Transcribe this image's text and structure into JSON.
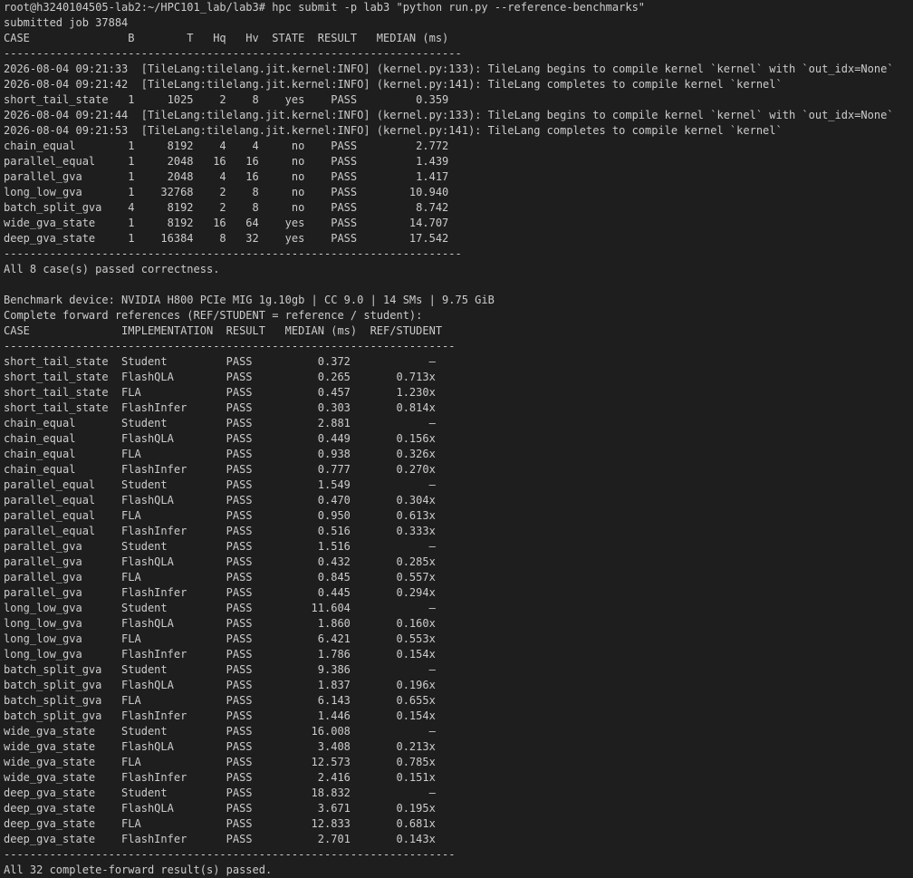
{
  "terminal": {
    "lines": [
      "root@h3240104505-lab2:~/HPC101_lab/lab3# hpc submit -p lab3 \"python run.py --reference-benchmarks\"",
      "submitted job 37884",
      "CASE               B        T   Hq   Hv  STATE  RESULT   MEDIAN (ms)",
      "----------------------------------------------------------------------",
      "2026-08-04 09:21:33  [TileLang:tilelang.jit.kernel:INFO] (kernel.py:133): TileLang begins to compile kernel `kernel` with `out_idx=None`",
      "2026-08-04 09:21:42  [TileLang:tilelang.jit.kernel:INFO] (kernel.py:141): TileLang completes to compile kernel `kernel`",
      "short_tail_state   1     1025    2    8    yes    PASS         0.359",
      "2026-08-04 09:21:44  [TileLang:tilelang.jit.kernel:INFO] (kernel.py:133): TileLang begins to compile kernel `kernel` with `out_idx=None`",
      "2026-08-04 09:21:53  [TileLang:tilelang.jit.kernel:INFO] (kernel.py:141): TileLang completes to compile kernel `kernel`",
      "chain_equal        1     8192    4    4     no    PASS         2.772",
      "parallel_equal     1     2048   16   16     no    PASS         1.439",
      "parallel_gva       1     2048    4   16     no    PASS         1.417",
      "long_low_gva       1    32768    2    8     no    PASS        10.940",
      "batch_split_gva    4     8192    2    8     no    PASS         8.742",
      "wide_gva_state     1     8192   16   64    yes    PASS        14.707",
      "deep_gva_state     1    16384    8   32    yes    PASS        17.542",
      "----------------------------------------------------------------------",
      "All 8 case(s) passed correctness.",
      "",
      "Benchmark device: NVIDIA H800 PCIe MIG 1g.10gb | CC 9.0 | 14 SMs | 9.75 GiB",
      "Complete forward references (REF/STUDENT = reference / student):",
      "CASE              IMPLEMENTATION  RESULT   MEDIAN (ms)  REF/STUDENT",
      "---------------------------------------------------------------------",
      "short_tail_state  Student         PASS          0.372            —",
      "short_tail_state  FlashQLA        PASS          0.265       0.713x",
      "short_tail_state  FLA             PASS          0.457       1.230x",
      "short_tail_state  FlashInfer      PASS          0.303       0.814x",
      "chain_equal       Student         PASS          2.881            —",
      "chain_equal       FlashQLA        PASS          0.449       0.156x",
      "chain_equal       FLA             PASS          0.938       0.326x",
      "chain_equal       FlashInfer      PASS          0.777       0.270x",
      "parallel_equal    Student         PASS          1.549            —",
      "parallel_equal    FlashQLA        PASS          0.470       0.304x",
      "parallel_equal    FLA             PASS          0.950       0.613x",
      "parallel_equal    FlashInfer      PASS          0.516       0.333x",
      "parallel_gva      Student         PASS          1.516            —",
      "parallel_gva      FlashQLA        PASS          0.432       0.285x",
      "parallel_gva      FLA             PASS          0.845       0.557x",
      "parallel_gva      FlashInfer      PASS          0.445       0.294x",
      "long_low_gva      Student         PASS         11.604            —",
      "long_low_gva      FlashQLA        PASS          1.860       0.160x",
      "long_low_gva      FLA             PASS          6.421       0.553x",
      "long_low_gva      FlashInfer      PASS          1.786       0.154x",
      "batch_split_gva   Student         PASS          9.386            —",
      "batch_split_gva   FlashQLA        PASS          1.837       0.196x",
      "batch_split_gva   FLA             PASS          6.143       0.655x",
      "batch_split_gva   FlashInfer      PASS          1.446       0.154x",
      "wide_gva_state    Student         PASS         16.008            —",
      "wide_gva_state    FlashQLA        PASS          3.408       0.213x",
      "wide_gva_state    FLA             PASS         12.573       0.785x",
      "wide_gva_state    FlashInfer      PASS          2.416       0.151x",
      "deep_gva_state    Student         PASS         18.832            —",
      "deep_gva_state    FlashQLA        PASS          3.671       0.195x",
      "deep_gva_state    FLA             PASS         12.833       0.681x",
      "deep_gva_state    FlashInfer      PASS          2.701       0.143x",
      "---------------------------------------------------------------------",
      "All 32 complete-forward result(s) passed."
    ]
  }
}
